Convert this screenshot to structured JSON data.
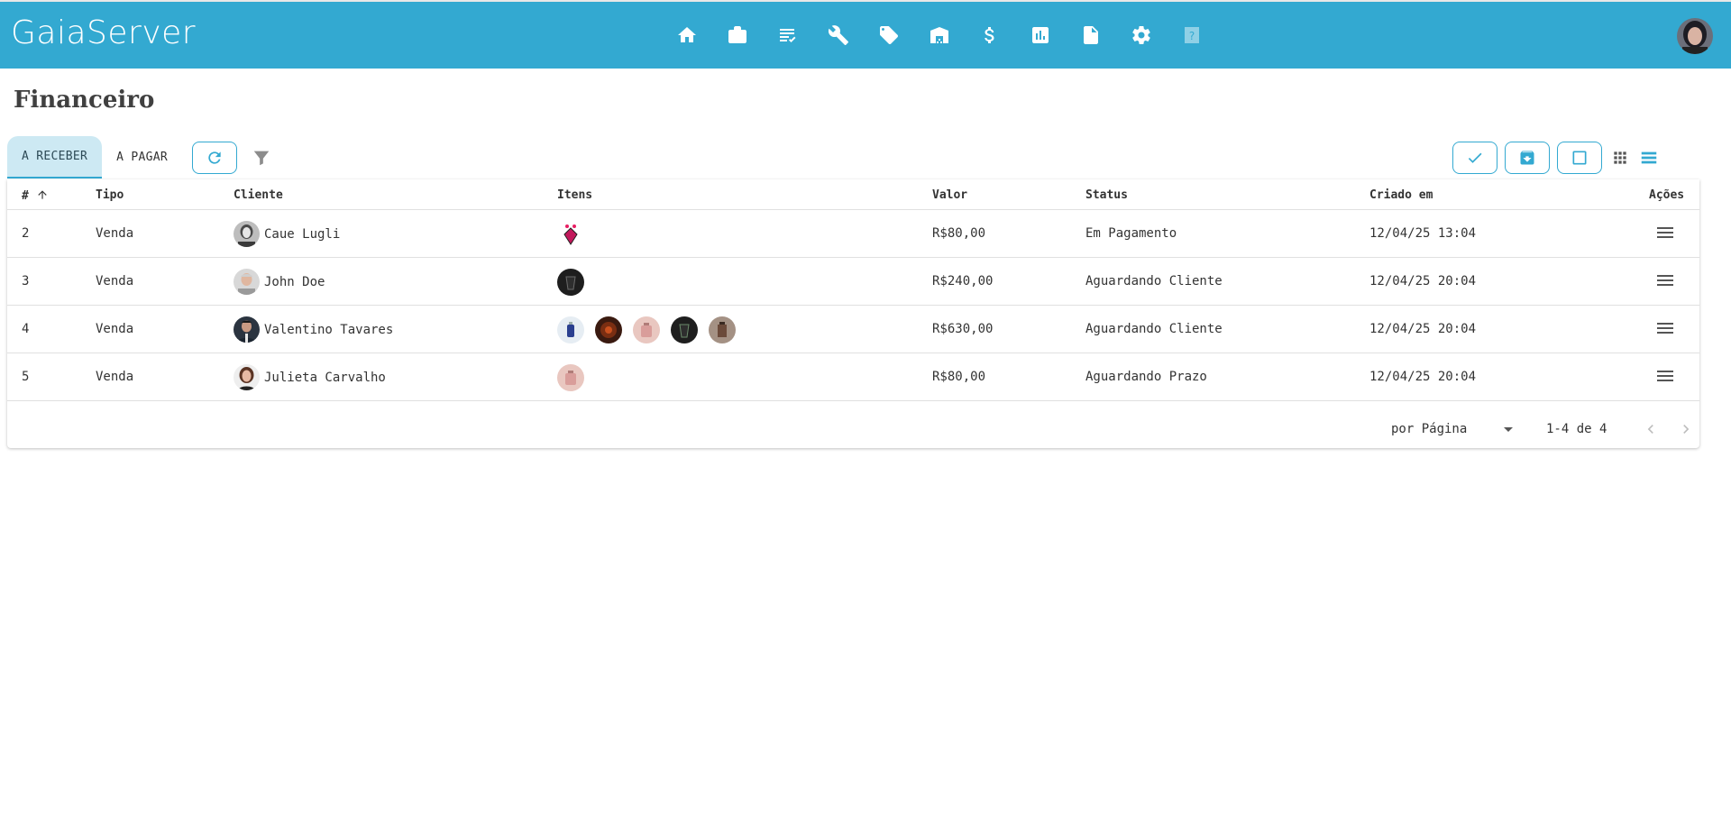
{
  "app": {
    "brand": "GaiaServer"
  },
  "nav": {
    "items": [
      {
        "icon": "home-icon"
      },
      {
        "icon": "briefcase-icon"
      },
      {
        "icon": "checklist-icon"
      },
      {
        "icon": "wrench-icon"
      },
      {
        "icon": "tag-icon"
      },
      {
        "icon": "warehouse-icon"
      },
      {
        "icon": "dollar-icon"
      },
      {
        "icon": "report-chart-icon"
      },
      {
        "icon": "document-icon"
      },
      {
        "icon": "gear-icon"
      },
      {
        "icon": "help-icon",
        "disabled": true
      }
    ]
  },
  "page": {
    "title": "Financeiro"
  },
  "tabs": [
    {
      "label": "A RECEBER",
      "active": true
    },
    {
      "label": "A PAGAR",
      "active": false
    }
  ],
  "table": {
    "columns": [
      "#",
      "Tipo",
      "Cliente",
      "Itens",
      "Valor",
      "Status",
      "Criado em",
      "Ações"
    ],
    "rows": [
      {
        "id": "2",
        "tipo": "Venda",
        "cliente": "Caue Lugli",
        "itens": 1,
        "valor": "R$80,00",
        "status": "Em Pagamento",
        "criado": "12/04/25 13:04"
      },
      {
        "id": "3",
        "tipo": "Venda",
        "cliente": "John Doe",
        "itens": 1,
        "valor": "R$240,00",
        "status": "Aguardando Cliente",
        "criado": "12/04/25 20:04"
      },
      {
        "id": "4",
        "tipo": "Venda",
        "cliente": "Valentino Tavares",
        "itens": 5,
        "valor": "R$630,00",
        "status": "Aguardando Cliente",
        "criado": "12/04/25 20:04"
      },
      {
        "id": "5",
        "tipo": "Venda",
        "cliente": "Julieta Carvalho",
        "itens": 1,
        "valor": "R$80,00",
        "status": "Aguardando Prazo",
        "criado": "12/04/25 20:04"
      }
    ]
  },
  "pagination": {
    "per_page_label": "por Página",
    "range": "1-4 de 4"
  },
  "colors": {
    "primary": "#33a9d1",
    "tab_active_bg": "#cde9f3"
  }
}
